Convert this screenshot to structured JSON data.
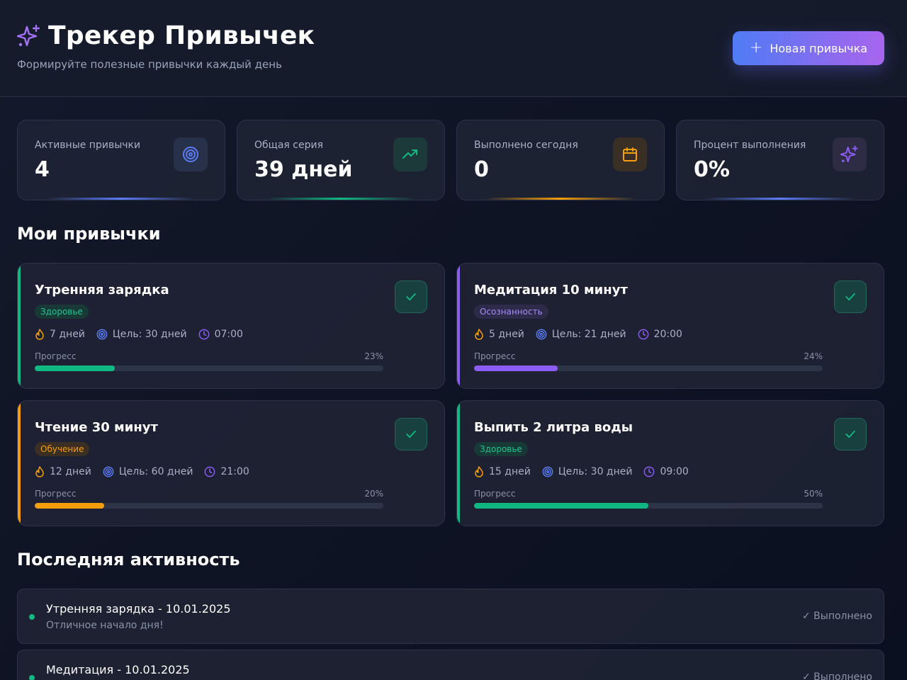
{
  "header": {
    "title": "Трекер Привычек",
    "subtitle": "Формируйте полезные привычки каждый день",
    "new_button_label": "Новая привычка",
    "title_icon": "sparkles-icon"
  },
  "stats": [
    {
      "label": "Активные привычки",
      "value": "4",
      "icon": "target-icon",
      "accent": "#5b7cf6"
    },
    {
      "label": "Общая серия",
      "value": "39 дней",
      "icon": "trending-up-icon",
      "accent": "#10b981"
    },
    {
      "label": "Выполнено сегодня",
      "value": "0",
      "icon": "calendar-icon",
      "accent": "#f59e0b"
    },
    {
      "label": "Процент выполнения",
      "value": "0%",
      "icon": "sparkles-icon",
      "accent": "#8b5cf6"
    }
  ],
  "habits_section": {
    "title": "Мои привычки"
  },
  "habits": [
    {
      "name": "Утренняя зарядка",
      "tag": "Здоровье",
      "streak": "7 дней",
      "goal": "Цель: 30 дней",
      "time": "07:00",
      "progress_label": "Прогресс",
      "progress_text": "23%",
      "progress": 0.23,
      "color": "#10b981"
    },
    {
      "name": "Медитация 10 минут",
      "tag": "Осознанность",
      "streak": "5 дней",
      "goal": "Цель: 21 дней",
      "time": "20:00",
      "progress_label": "Прогресс",
      "progress_text": "24%",
      "progress": 0.24,
      "color": "#8b5cf6"
    },
    {
      "name": "Чтение 30 минут",
      "tag": "Обучение",
      "streak": "12 дней",
      "goal": "Цель: 60 дней",
      "time": "21:00",
      "progress_label": "Прогресс",
      "progress_text": "20%",
      "progress": 0.2,
      "color": "#f59e0b"
    },
    {
      "name": "Выпить 2 литра воды",
      "tag": "Здоровье",
      "streak": "15 дней",
      "goal": "Цель: 30 дней",
      "time": "09:00",
      "progress_label": "Прогресс",
      "progress_text": "50%",
      "progress": 0.5,
      "color": "#10b981"
    }
  ],
  "activity_section": {
    "title": "Последняя активность"
  },
  "activity": [
    {
      "title": "Утренняя зарядка - 10.01.2025",
      "note": "Отличное начало дня!",
      "status": "✓ Выполнено"
    },
    {
      "title": "Медитация - 10.01.2025",
      "note": "",
      "status": "✓ Выполнено"
    }
  ],
  "colors": {
    "background": "#0f1424",
    "card": "#1e2334",
    "accent_blue": "#4f7cf5",
    "accent_purple": "#a866ee",
    "success": "#10b981"
  }
}
